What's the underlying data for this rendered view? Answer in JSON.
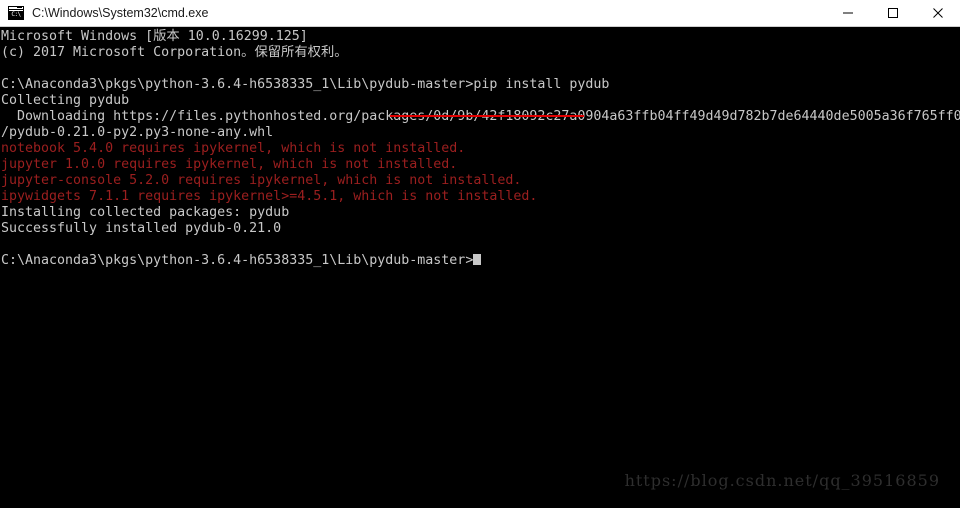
{
  "window": {
    "title": "C:\\Windows\\System32\\cmd.exe",
    "icon_name": "cmd-console-icon",
    "icon_text": "C:\\",
    "titlebar_bg": "#ffffff",
    "terminal_bg": "#000000",
    "text_color": "#c8c8c8",
    "warning_color": "#9c1f1f",
    "underline_color": "#e00000"
  },
  "controls": {
    "minimize_label": "Minimize",
    "maximize_label": "Maximize",
    "close_label": "Close"
  },
  "terminal": {
    "lines": [
      {
        "text": "Microsoft Windows [版本 10.0.16299.125]",
        "style": "normal"
      },
      {
        "text": "(c) 2017 Microsoft Corporation。保留所有权利。",
        "style": "normal"
      },
      {
        "text": "",
        "style": "blank"
      },
      {
        "text": "C:\\Anaconda3\\pkgs\\python-3.6.4-h6538335_1\\Lib\\pydub-master>pip install pydub",
        "style": "normal"
      },
      {
        "text": "Collecting pydub",
        "style": "normal"
      },
      {
        "text": "  Downloading https://files.pythonhosted.org/packages/0d/9b/42f18092c27a0904a63ffb04ff49d49d782b7de64440de5005a36f765ff0",
        "style": "normal"
      },
      {
        "text": "/pydub-0.21.0-py2.py3-none-any.whl",
        "style": "normal"
      },
      {
        "text": "notebook 5.4.0 requires ipykernel, which is not installed.",
        "style": "red"
      },
      {
        "text": "jupyter 1.0.0 requires ipykernel, which is not installed.",
        "style": "red"
      },
      {
        "text": "jupyter-console 5.2.0 requires ipykernel, which is not installed.",
        "style": "red"
      },
      {
        "text": "ipywidgets 7.1.1 requires ipykernel>=4.5.1, which is not installed.",
        "style": "red"
      },
      {
        "text": "Installing collected packages: pydub",
        "style": "normal"
      },
      {
        "text": "Successfully installed pydub-0.21.0",
        "style": "normal"
      },
      {
        "text": "",
        "style": "blank"
      },
      {
        "text": "C:\\Anaconda3\\pkgs\\python-3.6.4-h6538335_1\\Lib\\pydub-master>",
        "style": "prompt"
      }
    ],
    "command": "pip install pydub",
    "prompt_path": "C:\\Anaconda3\\pkgs\\python-3.6.4-h6538335_1\\Lib\\pydub-master>"
  },
  "watermark": {
    "text": "https://blog.csdn.net/qq_39516859"
  }
}
